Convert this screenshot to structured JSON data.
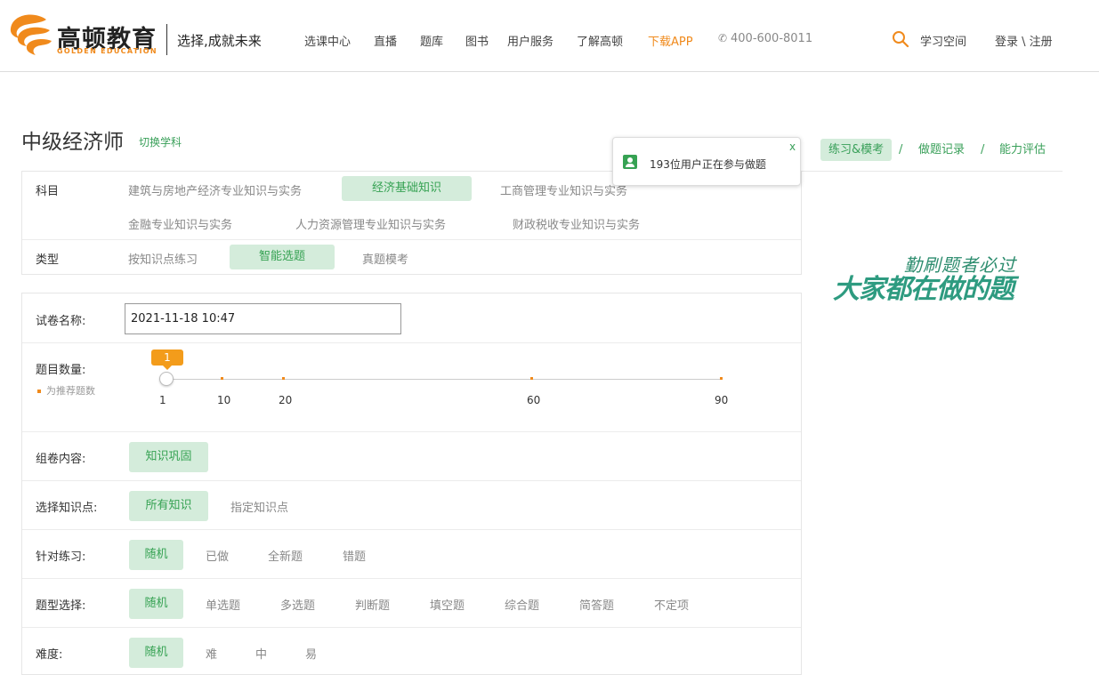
{
  "header": {
    "logo_cn": "高顿教育",
    "logo_en": "GOLDEN EDUCATION",
    "slogan": "选择,成就未来",
    "nav": [
      "选课中心",
      "直播",
      "题库",
      "图书",
      "用户服务",
      "了解高顿",
      "下载APP"
    ],
    "phone": "400-600-8011",
    "study_space": "学习空间",
    "login": "登录 \\ 注册",
    "colors": {
      "accent": "#f08a1c",
      "green": "#36a253"
    }
  },
  "page": {
    "title": "中级经济师",
    "switch_subject": "切换学科"
  },
  "toast": {
    "text": "193位用户正在参与做题",
    "close": "x"
  },
  "right_tabs": {
    "items": [
      "练习&模考",
      "做题记录",
      "能力评估"
    ],
    "sep": "/",
    "active": "练习&模考"
  },
  "filters": {
    "subject_label": "科目",
    "subjects": [
      "建筑与房地产经济专业知识与实务",
      "经济基础知识",
      "工商管理专业知识与实务",
      "金融专业知识与实务",
      "人力资源管理专业知识与实务",
      "财政税收专业知识与实务"
    ],
    "subject_selected": "经济基础知识",
    "type_label": "类型",
    "types": [
      "按知识点练习",
      "智能选题",
      "真题模考"
    ],
    "type_selected": "智能选题"
  },
  "form": {
    "name_label": "试卷名称:",
    "name_value": "2021-11-18 10:47",
    "count_label": "题目数量:",
    "count_value": "1",
    "count_ticks": [
      "1",
      "10",
      "20",
      "60",
      "90"
    ],
    "rec_note": "为推荐题数",
    "content_label": "组卷内容:",
    "content_options": [
      "知识巩固"
    ],
    "kp_label": "选择知识点:",
    "kp_options": [
      "所有知识",
      "指定知识点"
    ],
    "target_label": "针对练习:",
    "target_options": [
      "随机",
      "已做",
      "全新题",
      "错题"
    ],
    "qtype_label": "题型选择:",
    "qtype_options": [
      "随机",
      "单选题",
      "多选题",
      "判断题",
      "填空题",
      "综合题",
      "简答题",
      "不定项"
    ],
    "difficulty_label": "难度:",
    "difficulty_options": [
      "随机",
      "难",
      "中",
      "易"
    ]
  },
  "promo": {
    "sub": "勤刷题者必过",
    "main": "大家都在做的题"
  }
}
